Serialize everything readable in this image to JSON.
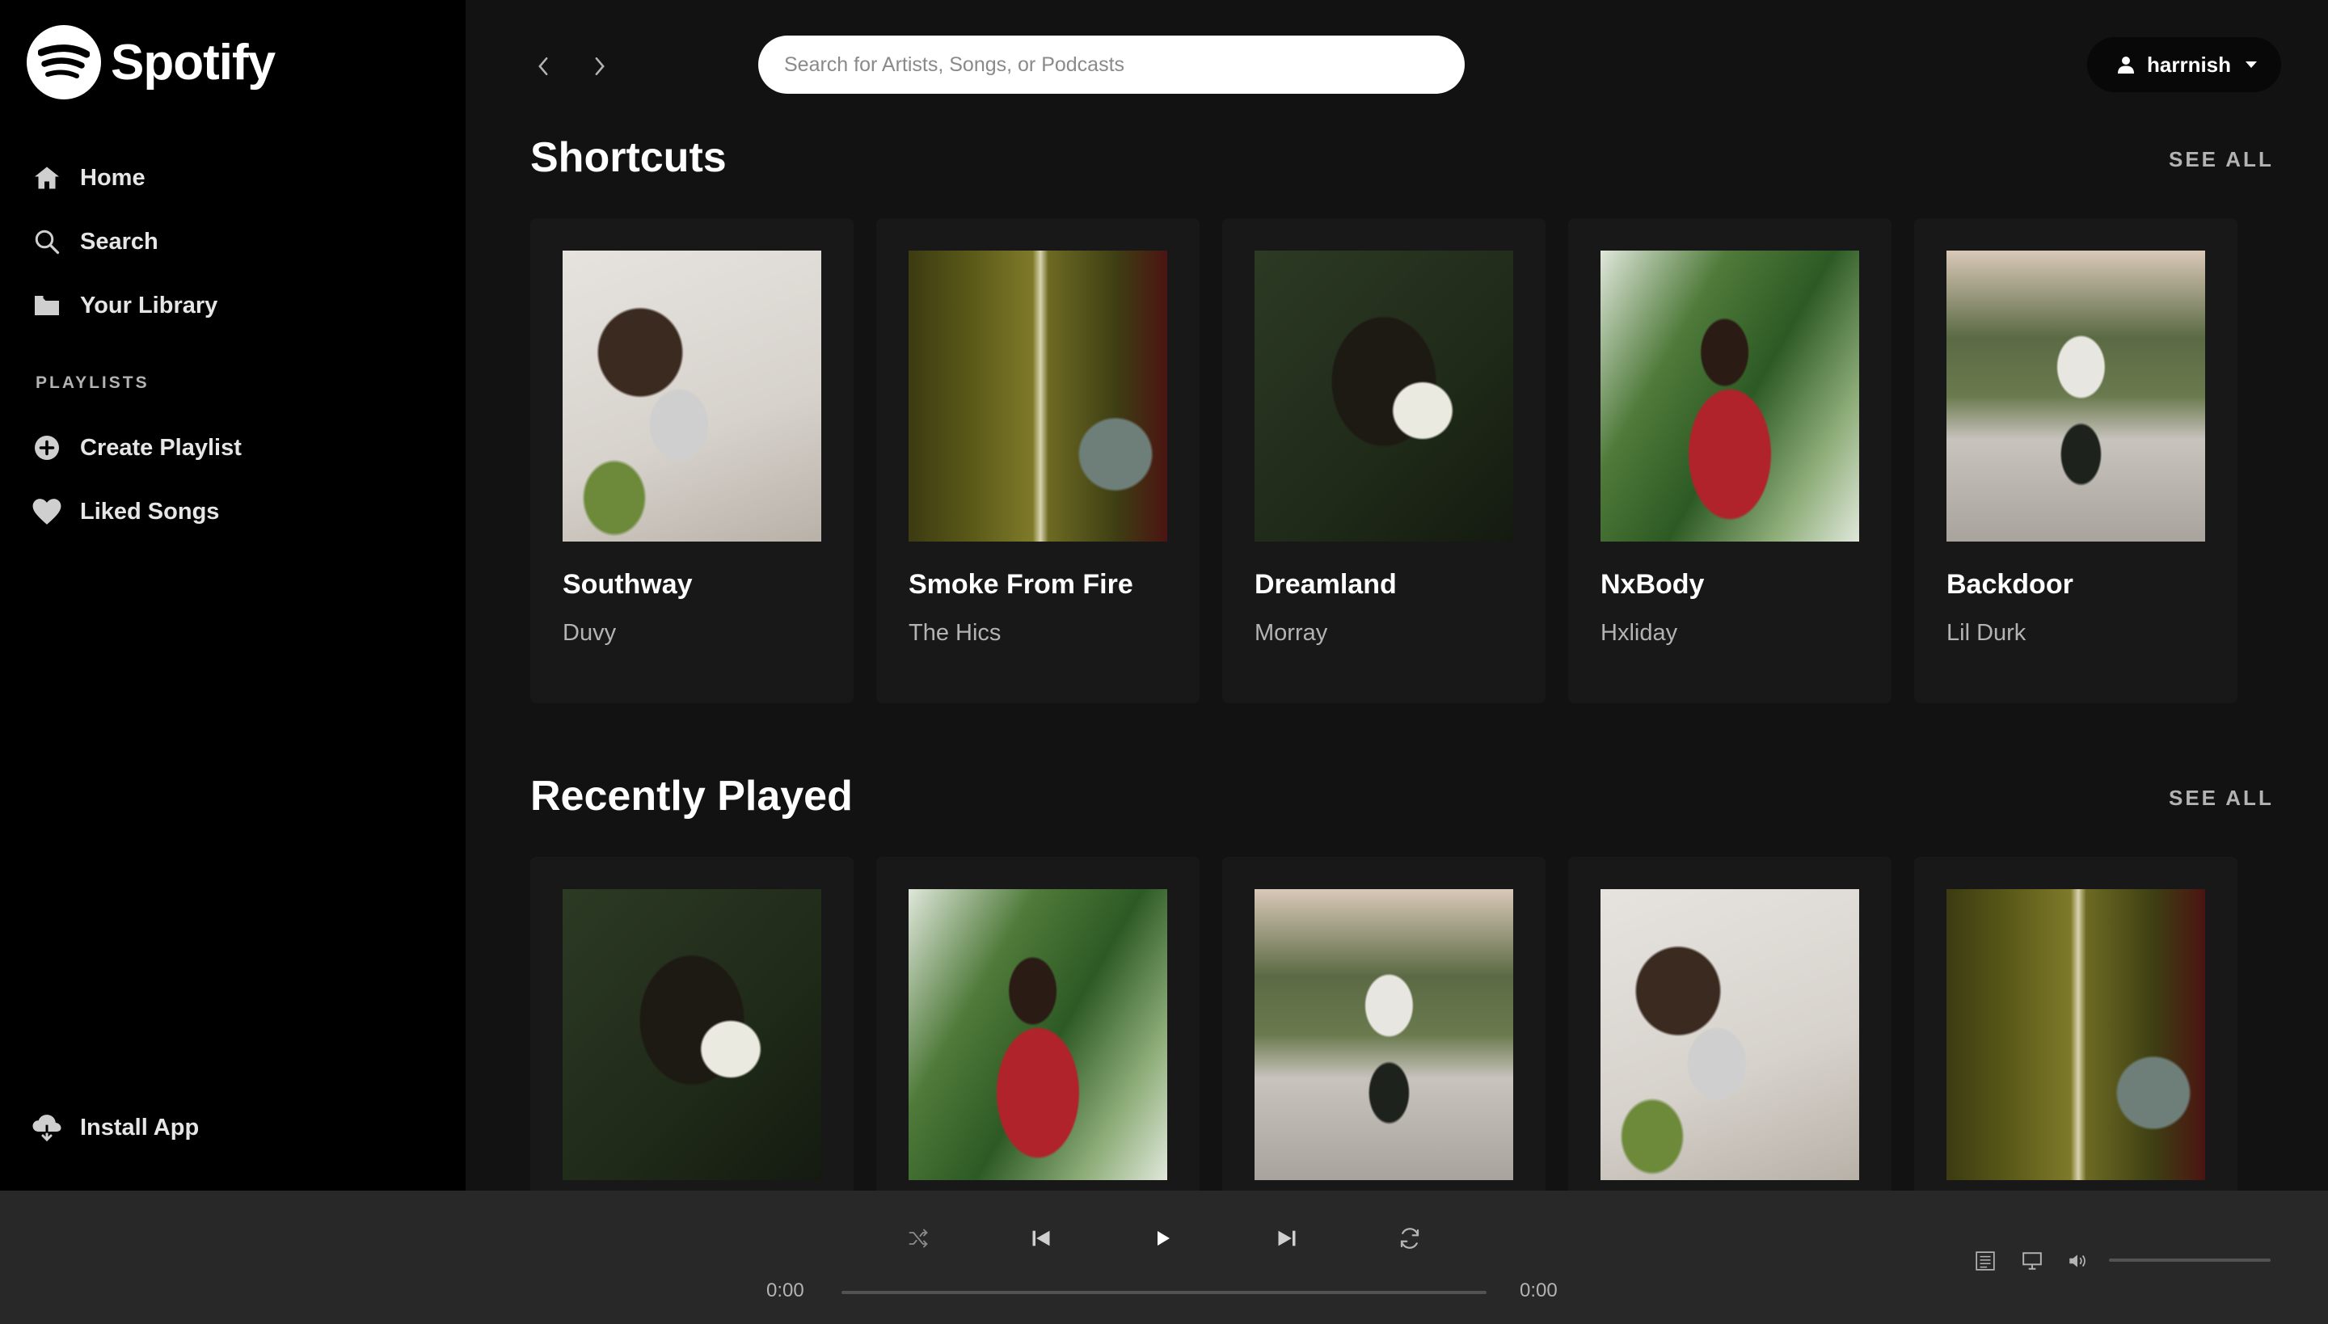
{
  "app": {
    "name": "Spotify"
  },
  "sidebar": {
    "nav": [
      {
        "label": "Home",
        "icon": "home-icon"
      },
      {
        "label": "Search",
        "icon": "search-icon"
      },
      {
        "label": "Your Library",
        "icon": "library-icon"
      }
    ],
    "playlists_heading": "PLAYLISTS",
    "playlist_actions": [
      {
        "label": "Create Playlist",
        "icon": "plus-circle-icon"
      },
      {
        "label": "Liked Songs",
        "icon": "heart-icon"
      }
    ],
    "install_label": "Install App"
  },
  "topbar": {
    "search_placeholder": "Search for Artists, Songs, or Podcasts",
    "username": "harrnish"
  },
  "shortcuts": {
    "title": "Shortcuts",
    "see_all": "SEE ALL",
    "cards": [
      {
        "title": "Southway",
        "artist": "Duvy"
      },
      {
        "title": "Smoke From Fire",
        "artist": "The Hics"
      },
      {
        "title": "Dreamland",
        "artist": "Morray"
      },
      {
        "title": "NxBody",
        "artist": "Hxliday"
      },
      {
        "title": "Backdoor",
        "artist": "Lil Durk"
      }
    ]
  },
  "recently_played": {
    "title": "Recently Played",
    "see_all": "SEE ALL"
  },
  "player": {
    "current_time": "0:00",
    "total_time": "0:00"
  },
  "colors": {
    "background": "#121212",
    "sidebar": "#000000",
    "card": "#181818",
    "player": "#282828",
    "muted_text": "#b3b3b3"
  }
}
